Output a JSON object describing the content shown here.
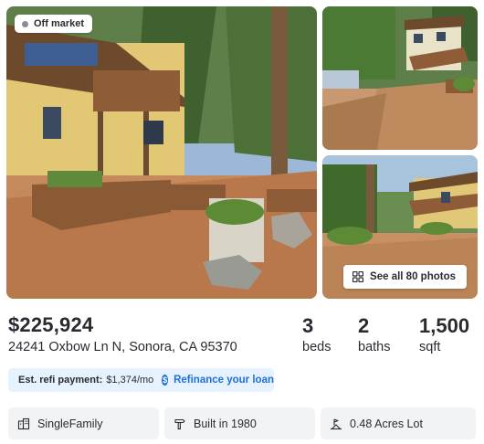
{
  "listing": {
    "status_badge": "Off market",
    "price": "$225,924",
    "address": "24241 Oxbow Ln N, Sonora, CA 95370"
  },
  "gallery": {
    "see_all_label": "See all 80 photos",
    "icons": {
      "see_all": "grid-icon"
    }
  },
  "stats": {
    "beds": {
      "value": "3",
      "label": "beds"
    },
    "baths": {
      "value": "2",
      "label": "baths"
    },
    "sqft": {
      "value": "1,500",
      "label": "sqft"
    }
  },
  "refinance": {
    "label": "Est. refi payment:",
    "amount": "$1,374/mo",
    "icon": "dollar-icon",
    "link_label": "Refinance your loan"
  },
  "facts": [
    {
      "icon": "building-icon",
      "text": "SingleFamily"
    },
    {
      "icon": "hammer-icon",
      "text": "Built in 1980"
    },
    {
      "icon": "lot-icon",
      "text": "0.48 Acres Lot"
    }
  ],
  "colors": {
    "accent": "#1f6fe0",
    "refi_background": "#e6f2fd",
    "fact_background": "#f2f3f5",
    "status_dot": "#8a8d99",
    "text": "#2a2a33"
  }
}
